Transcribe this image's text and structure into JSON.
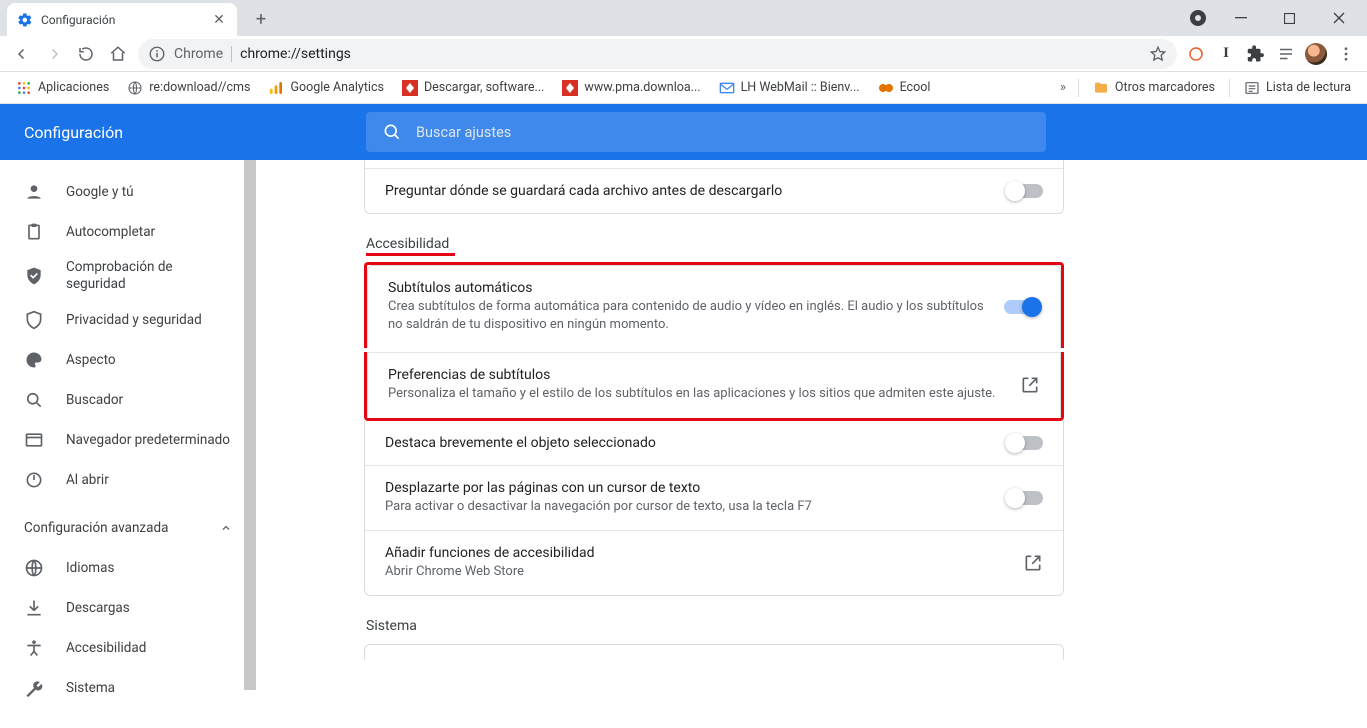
{
  "tab": {
    "title": "Configuración"
  },
  "omnibox": {
    "prefix": "Chrome",
    "path": "chrome://settings"
  },
  "bookmarks": {
    "items": [
      {
        "label": "Aplicaciones"
      },
      {
        "label": "re:download//cms"
      },
      {
        "label": "Google Analytics"
      },
      {
        "label": "Descargar, software..."
      },
      {
        "label": "www.pma.downloa..."
      },
      {
        "label": "LH WebMail :: Bienv..."
      },
      {
        "label": "Ecool"
      }
    ],
    "right": {
      "other": "Otros marcadores",
      "reading": "Lista de lectura"
    }
  },
  "header": {
    "title": "Configuración",
    "searchPlaceholder": "Buscar ajustes"
  },
  "sidebar": {
    "items": [
      {
        "label": "Google y tú"
      },
      {
        "label": "Autocompletar"
      },
      {
        "label": "Comprobación de seguridad"
      },
      {
        "label": "Privacidad y seguridad"
      },
      {
        "label": "Aspecto"
      },
      {
        "label": "Buscador"
      },
      {
        "label": "Navegador predeterminado"
      },
      {
        "label": "Al abrir"
      }
    ],
    "advanced": "Configuración avanzada",
    "subitems": [
      {
        "label": "Idiomas"
      },
      {
        "label": "Descargas"
      },
      {
        "label": "Accesibilidad"
      },
      {
        "label": "Sistema"
      }
    ]
  },
  "main": {
    "downloadRow": {
      "title": "Preguntar dónde se guardará cada archivo antes de descargarlo"
    },
    "section1": "Accesibilidad",
    "rows": [
      {
        "title": "Subtítulos automáticos",
        "desc": "Crea subtítulos de forma automática para contenido de audio y vídeo en inglés. El audio y los subtítulos no saldrán de tu dispositivo en ningún momento.",
        "toggle": true,
        "on": true
      },
      {
        "title": "Preferencias de subtítulos",
        "desc": "Personaliza el tamaño y el estilo de los subtítulos en las aplicaciones y los sitios que admiten este ajuste.",
        "launch": true
      },
      {
        "title": "Destaca brevemente el objeto seleccionado",
        "toggle": true,
        "on": false
      },
      {
        "title": "Desplazarte por las páginas con un cursor de texto",
        "desc": "Para activar o desactivar la navegación por cursor de texto, usa la tecla F7",
        "toggle": true,
        "on": false
      },
      {
        "title": "Añadir funciones de accesibilidad",
        "desc": "Abrir Chrome Web Store",
        "launch": true
      }
    ],
    "section2": "Sistema"
  }
}
